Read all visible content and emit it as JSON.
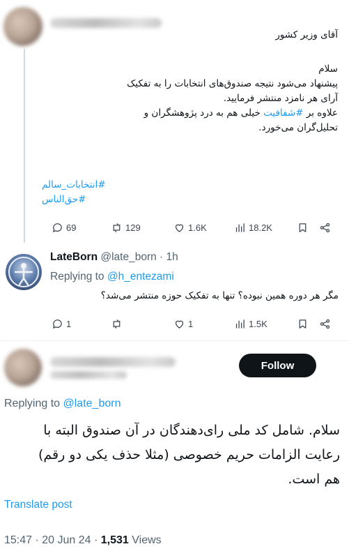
{
  "tweet1": {
    "greeting_line": "آقای وزیر کشور",
    "body_lines": [
      "سلام",
      "پیشنهاد می‌شود نتیجه صندوق‌های انتخابات را به تفکیک",
      "آرای هر نامزد منتشر فرمایید.",
      "علاوه بر ",
      "خیلی هم به درد پژوهشگران و",
      "تحلیل‌گران می‌خورد."
    ],
    "inline_hashtag": "#شفافیت",
    "hashtags": [
      "انتخابات_سالم#",
      "حق‌الناس#"
    ],
    "actions": {
      "replies": "69",
      "reposts": "129",
      "likes": "1.6K",
      "views": "18.2K"
    }
  },
  "reply": {
    "display_name": "LateBorn",
    "handle": "@late_born",
    "time": "· 1h",
    "replying_label": "Replying to",
    "replying_to": "@h_entezami",
    "text": "مگر هر دوره همین نبوده؟ تنها به تفکیک حوزه منتشر می‌شد؟",
    "actions": {
      "replies": "1",
      "reposts": "",
      "likes": "1",
      "views": "1.5K"
    }
  },
  "main": {
    "follow_label": "Follow",
    "replying_label": "Replying to",
    "replying_to": "@late_born",
    "text_lines": [
      "سلام. شامل کد ملی رای‌دهندگان در آن صندوق البته با",
      "رعایت الزامات حریم خصوصی (مثلا حذف یکی دو رقم)",
      "هم است."
    ],
    "translate_label": "Translate post",
    "time": "15:47 · 20 Jun 24 · ",
    "views_count": "1,531",
    "views_label": " Views"
  },
  "colors": {
    "link": "#1d9bf0",
    "text": "#0f1419",
    "muted": "#536471",
    "follow_bg": "#0f1419"
  }
}
